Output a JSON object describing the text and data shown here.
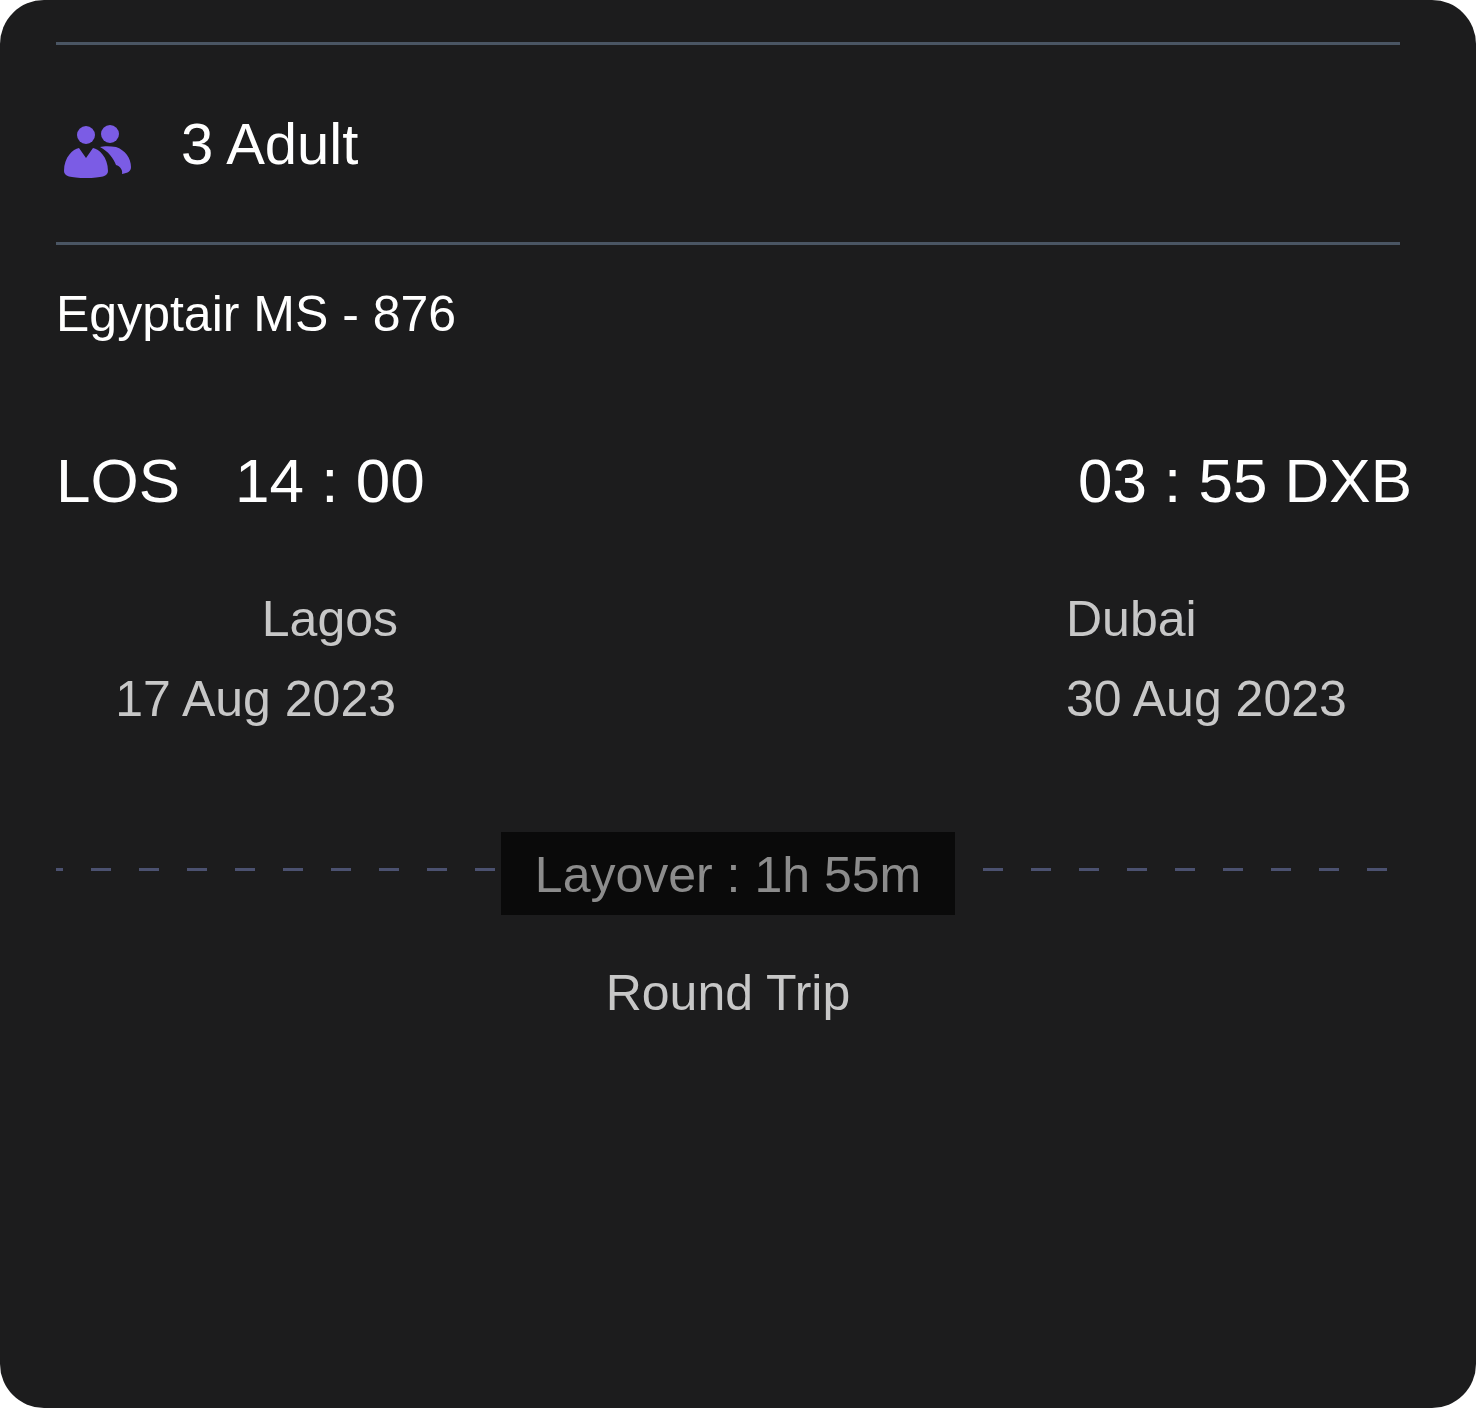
{
  "passengers": {
    "label": "3 Adult"
  },
  "flight": {
    "name": "Egyptair MS - 876"
  },
  "departure": {
    "code": "LOS",
    "time": "14 : 00",
    "city": "Lagos",
    "date": "17 Aug 2023"
  },
  "arrival": {
    "time": "03 : 55",
    "code": "DXB",
    "city": "Dubai",
    "date": "30 Aug 2023"
  },
  "layover": {
    "label": "Layover : 1h 55m"
  },
  "trip_type": "Round Trip"
}
